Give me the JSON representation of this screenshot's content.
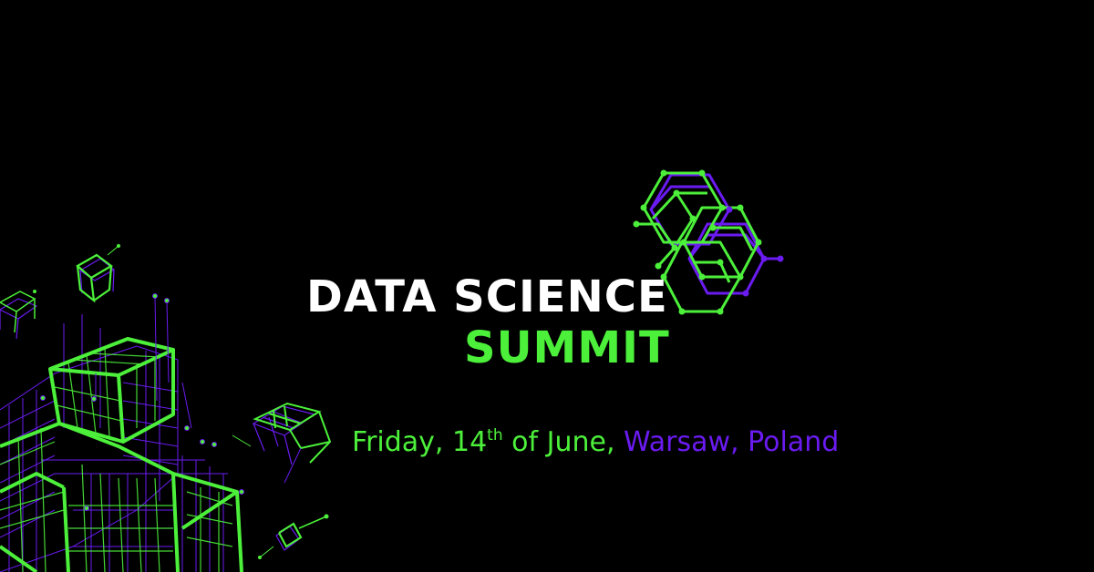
{
  "event": {
    "title_line_1": "DATA SCIENCE",
    "title_line_2": "SUMMIT",
    "date_prefix": "Friday, 14",
    "date_ordinal": "th",
    "date_suffix": " of June, ",
    "location": "Warsaw, Poland"
  },
  "colors": {
    "background": "#000000",
    "accent_green": "#4cf03a",
    "accent_purple": "#6a1bf0",
    "text_white": "#ffffff"
  },
  "icons": {
    "logo": "hexagon-cubes-logo",
    "decoration": "wireframe-cubes"
  }
}
